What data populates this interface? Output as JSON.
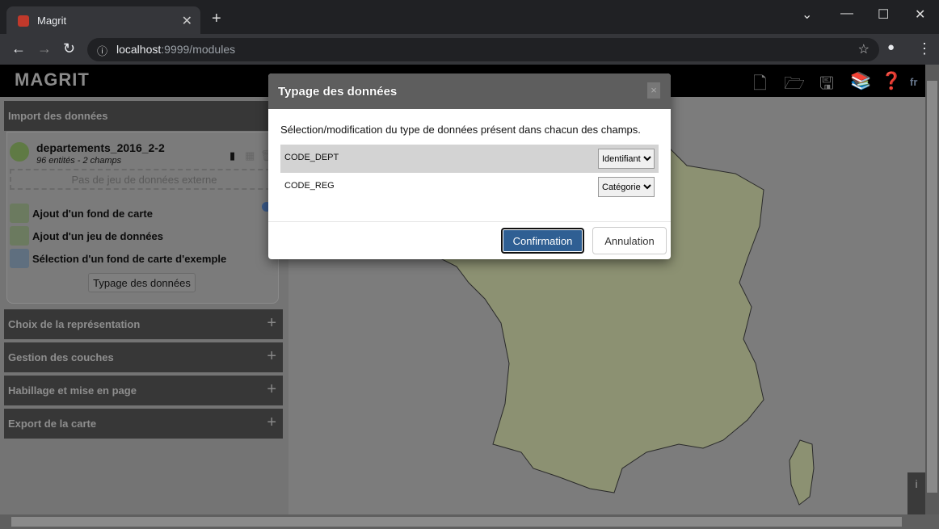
{
  "browser": {
    "tab_title": "Magrit",
    "url_host": "localhost",
    "url_rest": ":9999/modules"
  },
  "app": {
    "logo": "MAGRIT",
    "lang": "fr",
    "header_icons": [
      "new-file-icon",
      "open-folder-icon",
      "save-icon",
      "book-icon",
      "help-icon"
    ]
  },
  "sidebar": {
    "sections": [
      {
        "label": "Import des données"
      },
      {
        "label": "Choix de la représentation"
      },
      {
        "label": "Gestion des couches"
      },
      {
        "label": "Habillage et mise en page"
      },
      {
        "label": "Export de la carte"
      }
    ],
    "layer": {
      "name": "departements_2016_2-2",
      "info": "96 entités - 2 champs"
    },
    "external": "Pas de jeu de données externe",
    "actions": [
      {
        "label": "Ajout d'un fond de carte"
      },
      {
        "label": "Ajout d'un jeu de données"
      },
      {
        "label": "Sélection d'un fond de carte d'exemple"
      }
    ],
    "typage_button": "Typage des données"
  },
  "modal": {
    "title": "Typage des données",
    "close": "×",
    "description": "Sélection/modification du type de données présent dans chacun des champs.",
    "fields": [
      {
        "name": "CODE_DEPT",
        "type": "Identifiant"
      },
      {
        "name": "CODE_REG",
        "type": "Catégorie"
      }
    ],
    "confirm": "Confirmation",
    "cancel": "Annulation"
  },
  "colors": {
    "map_fill": "#8c9172",
    "accent": "#2f5f93"
  }
}
